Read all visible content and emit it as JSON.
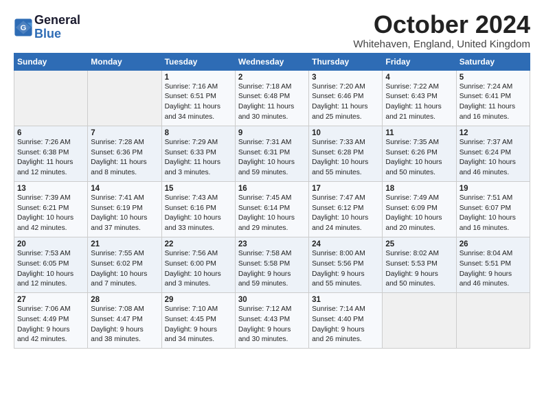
{
  "logo": {
    "line1": "General",
    "line2": "Blue"
  },
  "title": "October 2024",
  "subtitle": "Whitehaven, England, United Kingdom",
  "headers": [
    "Sunday",
    "Monday",
    "Tuesday",
    "Wednesday",
    "Thursday",
    "Friday",
    "Saturday"
  ],
  "weeks": [
    [
      {
        "day": "",
        "info": ""
      },
      {
        "day": "",
        "info": ""
      },
      {
        "day": "1",
        "info": "Sunrise: 7:16 AM\nSunset: 6:51 PM\nDaylight: 11 hours\nand 34 minutes."
      },
      {
        "day": "2",
        "info": "Sunrise: 7:18 AM\nSunset: 6:48 PM\nDaylight: 11 hours\nand 30 minutes."
      },
      {
        "day": "3",
        "info": "Sunrise: 7:20 AM\nSunset: 6:46 PM\nDaylight: 11 hours\nand 25 minutes."
      },
      {
        "day": "4",
        "info": "Sunrise: 7:22 AM\nSunset: 6:43 PM\nDaylight: 11 hours\nand 21 minutes."
      },
      {
        "day": "5",
        "info": "Sunrise: 7:24 AM\nSunset: 6:41 PM\nDaylight: 11 hours\nand 16 minutes."
      }
    ],
    [
      {
        "day": "6",
        "info": "Sunrise: 7:26 AM\nSunset: 6:38 PM\nDaylight: 11 hours\nand 12 minutes."
      },
      {
        "day": "7",
        "info": "Sunrise: 7:28 AM\nSunset: 6:36 PM\nDaylight: 11 hours\nand 8 minutes."
      },
      {
        "day": "8",
        "info": "Sunrise: 7:29 AM\nSunset: 6:33 PM\nDaylight: 11 hours\nand 3 minutes."
      },
      {
        "day": "9",
        "info": "Sunrise: 7:31 AM\nSunset: 6:31 PM\nDaylight: 10 hours\nand 59 minutes."
      },
      {
        "day": "10",
        "info": "Sunrise: 7:33 AM\nSunset: 6:28 PM\nDaylight: 10 hours\nand 55 minutes."
      },
      {
        "day": "11",
        "info": "Sunrise: 7:35 AM\nSunset: 6:26 PM\nDaylight: 10 hours\nand 50 minutes."
      },
      {
        "day": "12",
        "info": "Sunrise: 7:37 AM\nSunset: 6:24 PM\nDaylight: 10 hours\nand 46 minutes."
      }
    ],
    [
      {
        "day": "13",
        "info": "Sunrise: 7:39 AM\nSunset: 6:21 PM\nDaylight: 10 hours\nand 42 minutes."
      },
      {
        "day": "14",
        "info": "Sunrise: 7:41 AM\nSunset: 6:19 PM\nDaylight: 10 hours\nand 37 minutes."
      },
      {
        "day": "15",
        "info": "Sunrise: 7:43 AM\nSunset: 6:16 PM\nDaylight: 10 hours\nand 33 minutes."
      },
      {
        "day": "16",
        "info": "Sunrise: 7:45 AM\nSunset: 6:14 PM\nDaylight: 10 hours\nand 29 minutes."
      },
      {
        "day": "17",
        "info": "Sunrise: 7:47 AM\nSunset: 6:12 PM\nDaylight: 10 hours\nand 24 minutes."
      },
      {
        "day": "18",
        "info": "Sunrise: 7:49 AM\nSunset: 6:09 PM\nDaylight: 10 hours\nand 20 minutes."
      },
      {
        "day": "19",
        "info": "Sunrise: 7:51 AM\nSunset: 6:07 PM\nDaylight: 10 hours\nand 16 minutes."
      }
    ],
    [
      {
        "day": "20",
        "info": "Sunrise: 7:53 AM\nSunset: 6:05 PM\nDaylight: 10 hours\nand 12 minutes."
      },
      {
        "day": "21",
        "info": "Sunrise: 7:55 AM\nSunset: 6:02 PM\nDaylight: 10 hours\nand 7 minutes."
      },
      {
        "day": "22",
        "info": "Sunrise: 7:56 AM\nSunset: 6:00 PM\nDaylight: 10 hours\nand 3 minutes."
      },
      {
        "day": "23",
        "info": "Sunrise: 7:58 AM\nSunset: 5:58 PM\nDaylight: 9 hours\nand 59 minutes."
      },
      {
        "day": "24",
        "info": "Sunrise: 8:00 AM\nSunset: 5:56 PM\nDaylight: 9 hours\nand 55 minutes."
      },
      {
        "day": "25",
        "info": "Sunrise: 8:02 AM\nSunset: 5:53 PM\nDaylight: 9 hours\nand 50 minutes."
      },
      {
        "day": "26",
        "info": "Sunrise: 8:04 AM\nSunset: 5:51 PM\nDaylight: 9 hours\nand 46 minutes."
      }
    ],
    [
      {
        "day": "27",
        "info": "Sunrise: 7:06 AM\nSunset: 4:49 PM\nDaylight: 9 hours\nand 42 minutes."
      },
      {
        "day": "28",
        "info": "Sunrise: 7:08 AM\nSunset: 4:47 PM\nDaylight: 9 hours\nand 38 minutes."
      },
      {
        "day": "29",
        "info": "Sunrise: 7:10 AM\nSunset: 4:45 PM\nDaylight: 9 hours\nand 34 minutes."
      },
      {
        "day": "30",
        "info": "Sunrise: 7:12 AM\nSunset: 4:43 PM\nDaylight: 9 hours\nand 30 minutes."
      },
      {
        "day": "31",
        "info": "Sunrise: 7:14 AM\nSunset: 4:40 PM\nDaylight: 9 hours\nand 26 minutes."
      },
      {
        "day": "",
        "info": ""
      },
      {
        "day": "",
        "info": ""
      }
    ]
  ]
}
